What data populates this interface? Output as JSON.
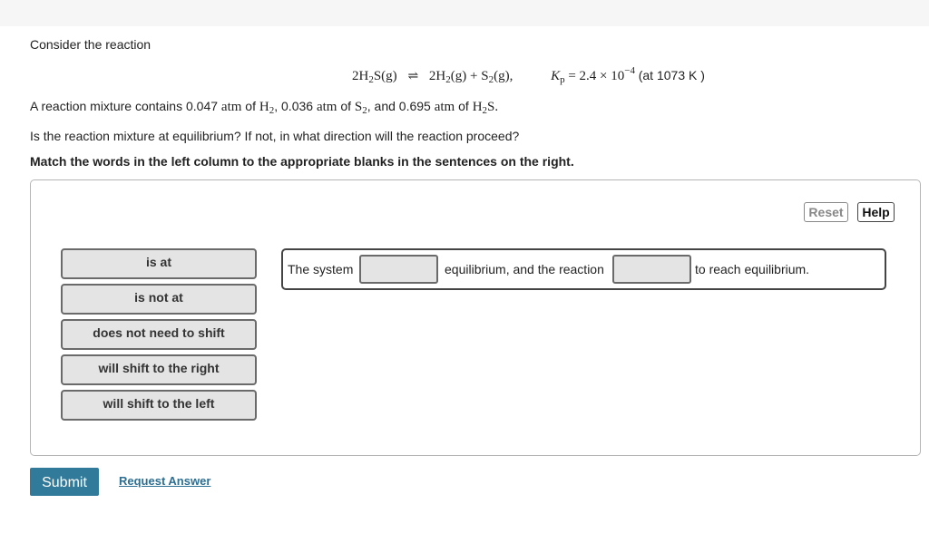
{
  "intro": "Consider the reaction",
  "equation": {
    "reactant_coef": "2",
    "reactant": [
      "H",
      "2",
      "S(g)"
    ],
    "arrow": "⇌",
    "product1_coef": "2",
    "product1": [
      "H",
      "2",
      "(g)"
    ],
    "plus": "+",
    "product2": [
      "S",
      "2",
      "(g),"
    ],
    "kp_symbol": "K",
    "kp_sub": "p",
    "kp_eq": " = 2.4 × 10",
    "kp_exp": "−4",
    "kp_temp": "(at 1073 K )"
  },
  "mixture": {
    "prefix": "A reaction mixture contains ",
    "h2_value": "0.047",
    "s2_value": "0.036",
    "h2s_value": "0.695",
    "unit": "atm",
    "of": " of ",
    "h2": [
      "H",
      "2"
    ],
    "s2": [
      "S",
      "2"
    ],
    "h2s": [
      "H",
      "2",
      "S."
    ],
    "comma": ", ",
    "and": ", and "
  },
  "question": "Is the reaction mixture at equilibrium? If not, in what direction will the reaction proceed?",
  "instruction": "Match the words in the left column to the appropriate blanks in the sentences on the right.",
  "buttons": {
    "reset": "Reset",
    "help": "Help",
    "submit": "Submit",
    "request_answer": "Request Answer"
  },
  "choices": [
    "is at",
    "is not at",
    "does not need to shift",
    "will shift to the right",
    "will shift to the left"
  ],
  "sentence": {
    "part1": "The system",
    "part2": "equilibrium, and the reaction",
    "part3": "to reach equilibrium.",
    "blank1_value": "",
    "blank2_value": ""
  },
  "colors": {
    "submit_bg": "#327a9a",
    "link": "#2d6f93",
    "chip_bg": "#e4e4e4"
  }
}
